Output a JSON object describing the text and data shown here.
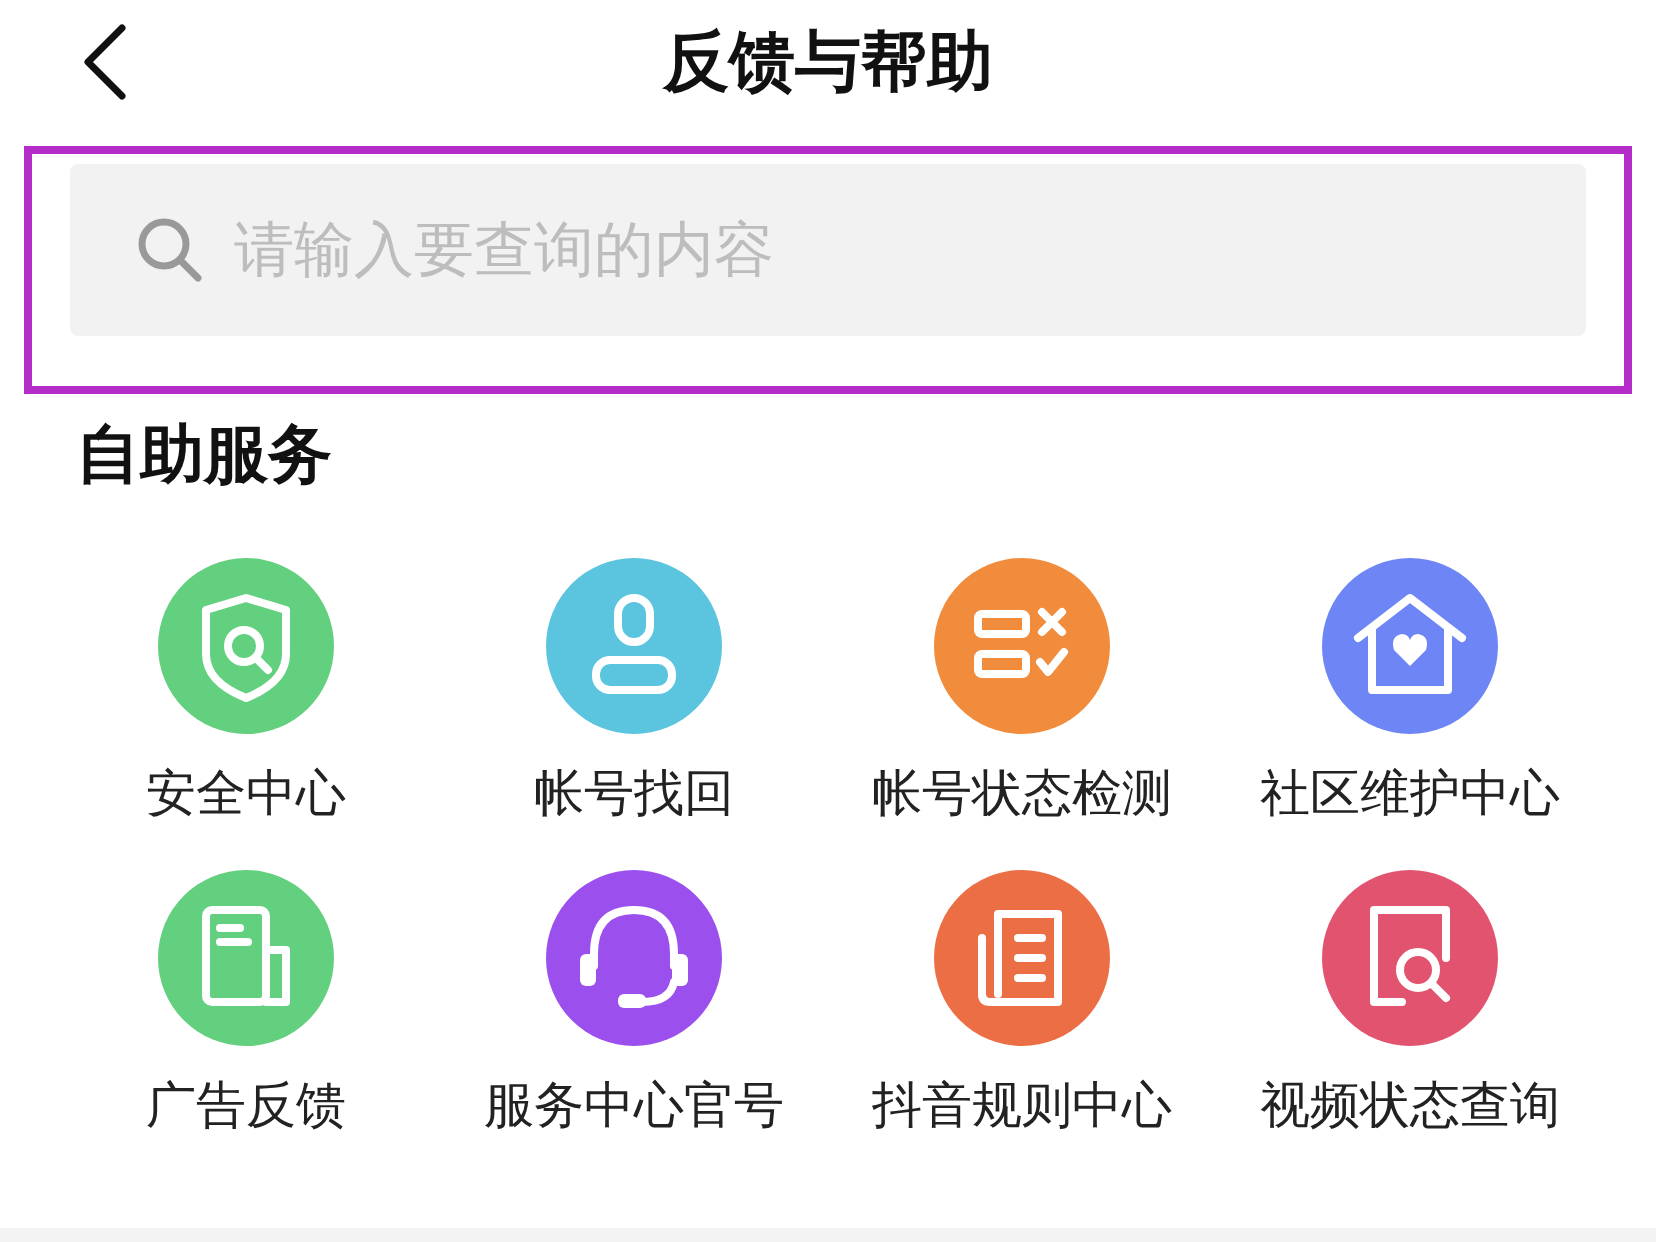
{
  "header": {
    "title": "反馈与帮助"
  },
  "search": {
    "placeholder": "请输入要查询的内容"
  },
  "section": {
    "title": "自助服务",
    "items": [
      {
        "label": "安全中心",
        "kind": "shield",
        "color": "#62d07e"
      },
      {
        "label": "帐号找回",
        "kind": "person",
        "color": "#5bc4de"
      },
      {
        "label": "帐号状态检测",
        "kind": "checklist",
        "color": "#f08c3c"
      },
      {
        "label": "社区维护中心",
        "kind": "house",
        "color": "#6e86f5"
      },
      {
        "label": "广告反馈",
        "kind": "newspaper",
        "color": "#62d07e"
      },
      {
        "label": "服务中心官号",
        "kind": "headset",
        "color": "#9b50ee"
      },
      {
        "label": "抖音规则中心",
        "kind": "document",
        "color": "#ec6e45"
      },
      {
        "label": "视频状态查询",
        "kind": "doc-search",
        "color": "#e2536f"
      }
    ]
  }
}
